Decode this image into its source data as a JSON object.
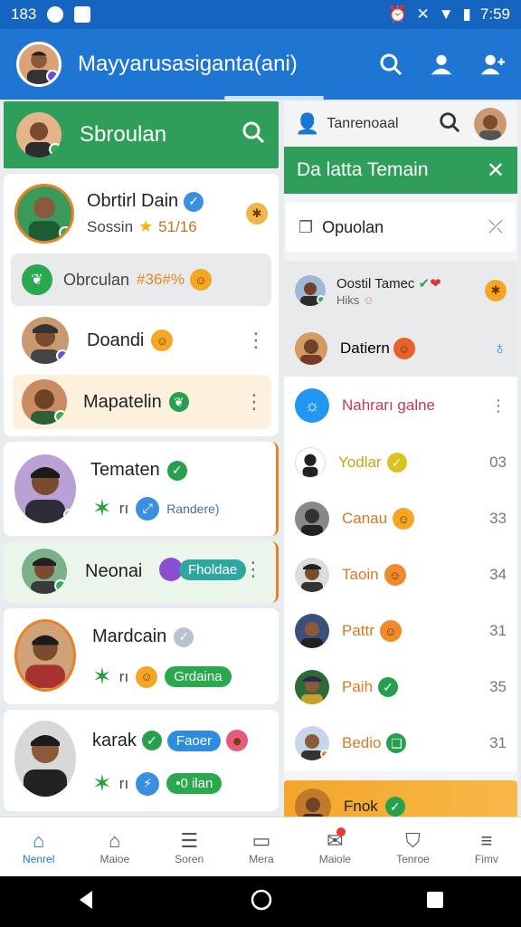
{
  "status": {
    "time_left": "183",
    "time_right": "7:59"
  },
  "appbar": {
    "title": "Mayyarusasiganta(ani)"
  },
  "left_header": {
    "title": "Sbroulan"
  },
  "left_cards": [
    {
      "name": "Obrtirl Dain",
      "sub": "Sossin",
      "sub2": "51/16"
    },
    {
      "name": "Obrculan",
      "tag": "#36#%"
    },
    {
      "name": "Doandi"
    },
    {
      "name": "Mapatelin"
    },
    {
      "name": "Tematen",
      "sub": "Randere)"
    },
    {
      "name": "Neonai",
      "pill": "Fholdae"
    },
    {
      "name": "Mardcain",
      "pill": "Grdaina"
    },
    {
      "name": "karak",
      "pill": "Faoer",
      "pill2": "•0 ilan"
    }
  ],
  "right_panel": {
    "top_title": "Tanrenoaal",
    "header_title": "Da latta Temain",
    "search_value": "Opuolan",
    "items": [
      {
        "name": "Oostil Tamec",
        "sub": "Hiks",
        "value": ""
      },
      {
        "name": "Datiern",
        "value": ""
      },
      {
        "name": "Nahrarı galne",
        "value": ""
      },
      {
        "name": "Yodlar",
        "value": "03"
      },
      {
        "name": "Canau",
        "value": "33"
      },
      {
        "name": "Taoin",
        "value": "34"
      },
      {
        "name": "Pattr",
        "value": "31"
      },
      {
        "name": "Paih",
        "value": "35"
      },
      {
        "name": "Bedio",
        "value": "31"
      },
      {
        "name": "Fnok",
        "value": ""
      }
    ]
  },
  "bottom_nav": [
    {
      "label": "Nenrel",
      "icon": "home-icon"
    },
    {
      "label": "Maioe",
      "icon": "house-outline-icon"
    },
    {
      "label": "Soren",
      "icon": "stack-icon"
    },
    {
      "label": "Mera",
      "icon": "card-icon"
    },
    {
      "label": "Maiole",
      "icon": "notification-icon"
    },
    {
      "label": "Tenroe",
      "icon": "shield-icon"
    },
    {
      "label": "Fimv",
      "icon": "menu-icon"
    }
  ],
  "colors": {
    "primary": "#1e76d2",
    "green": "#2e9e5a",
    "accent_orange": "#f6a623"
  }
}
